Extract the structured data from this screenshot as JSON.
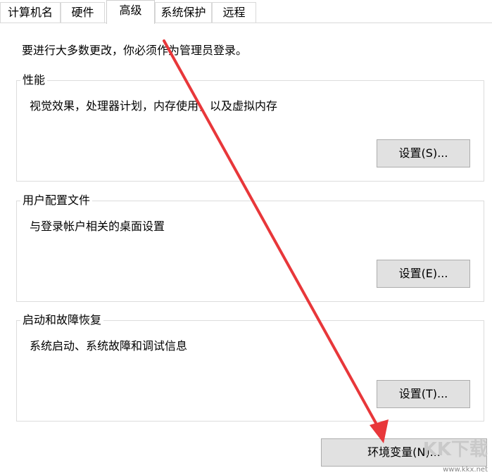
{
  "tabs": [
    {
      "label": "计算机名",
      "active": false
    },
    {
      "label": "硬件",
      "active": false
    },
    {
      "label": "高级",
      "active": true
    },
    {
      "label": "系统保护",
      "active": false
    },
    {
      "label": "远程",
      "active": false
    }
  ],
  "intro": "要进行大多数更改，你必须作为管理员登录。",
  "groups": {
    "performance": {
      "title": "性能",
      "description": "视觉效果，处理器计划，内存使用，以及虚拟内存",
      "button": "设置(S)..."
    },
    "profiles": {
      "title": "用户配置文件",
      "description": "与登录帐户相关的桌面设置",
      "button": "设置(E)..."
    },
    "startup": {
      "title": "启动和故障恢复",
      "description": "系统启动、系统故障和调试信息",
      "button": "设置(T)..."
    }
  },
  "env_button": "环境变量(N)...",
  "watermark": {
    "logo": "KK下载",
    "url": "www.kkx.net"
  },
  "colors": {
    "arrow": "#e8373a",
    "button_bg": "#e1e1e1",
    "border": "#dcdcdc"
  }
}
